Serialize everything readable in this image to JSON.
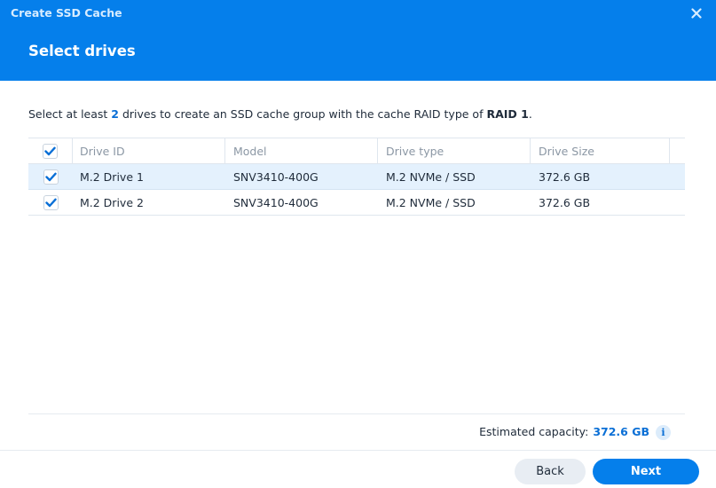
{
  "window": {
    "title": "Create SSD Cache",
    "close_icon": "close-icon"
  },
  "step": {
    "title": "Select drives"
  },
  "description": {
    "prefix": "Select at least ",
    "min_drives": "2",
    "middle": " drives to create an SSD cache group with the cache RAID type of ",
    "raid_type": "RAID 1",
    "suffix": "."
  },
  "table": {
    "select_all_checked": true,
    "columns": [
      "Drive ID",
      "Model",
      "Drive type",
      "Drive Size"
    ],
    "rows": [
      {
        "checked": true,
        "selected": true,
        "drive_id": "M.2 Drive 1",
        "model": "SNV3410-400G",
        "drive_type": "M.2 NVMe / SSD",
        "drive_size": "372.6 GB"
      },
      {
        "checked": true,
        "selected": false,
        "drive_id": "M.2 Drive 2",
        "model": "SNV3410-400G",
        "drive_type": "M.2 NVMe / SSD",
        "drive_size": "372.6 GB"
      }
    ]
  },
  "footer": {
    "capacity_label": "Estimated capacity:",
    "capacity_value": "372.6 GB",
    "info_icon_glyph": "i",
    "back_label": "Back",
    "next_label": "Next"
  },
  "colors": {
    "accent": "#057feb",
    "highlight_text": "#0a6fd6",
    "selected_row": "#e4f1fd"
  }
}
